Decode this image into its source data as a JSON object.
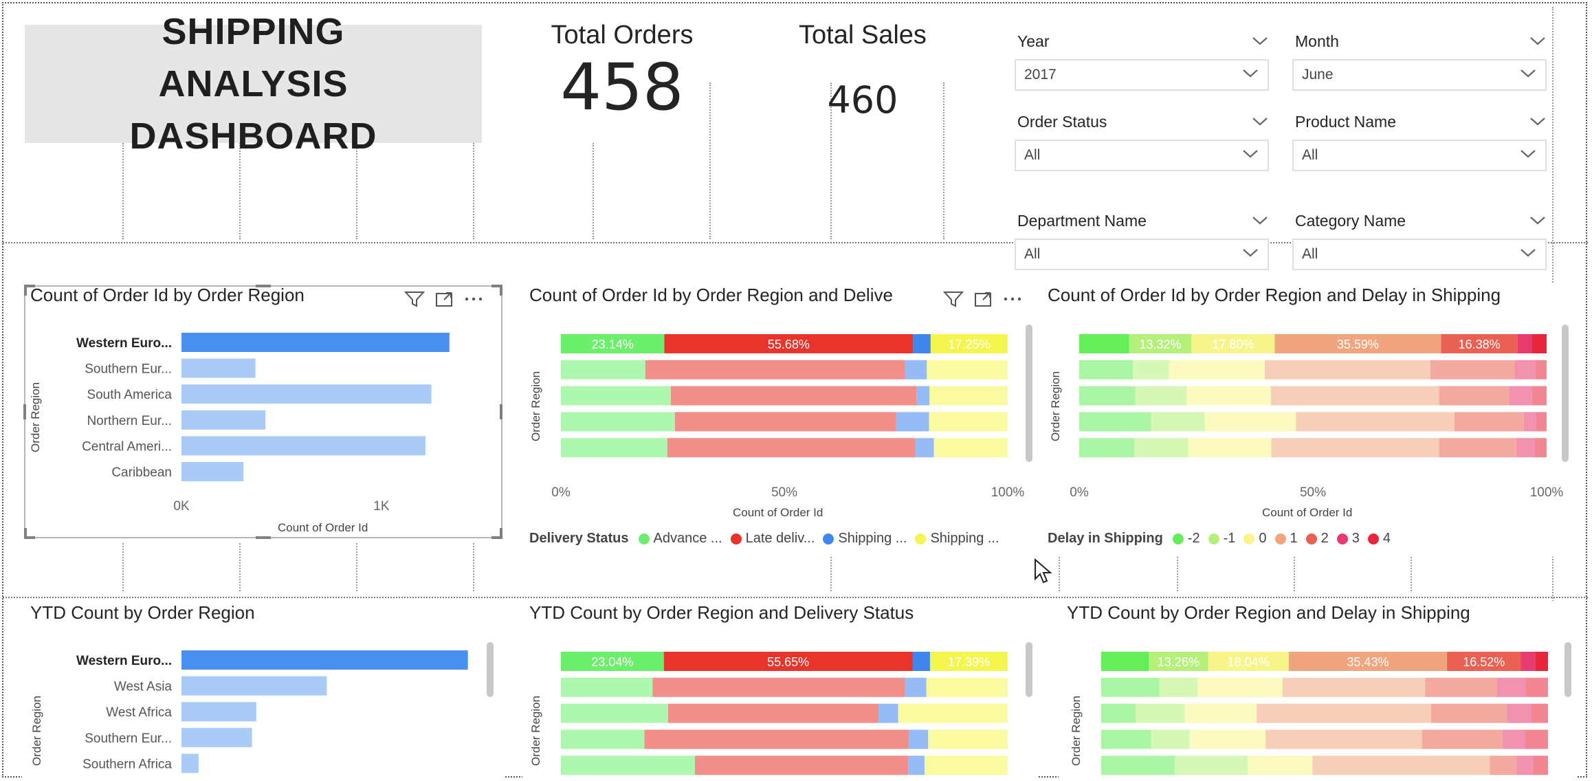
{
  "header": {
    "title": "SHIPPING ANALYSIS DASHBOARD"
  },
  "kpis": {
    "total_orders": {
      "label": "Total Orders",
      "value": "458"
    },
    "total_sales": {
      "label": "Total Sales",
      "value": "460"
    }
  },
  "slicers": [
    {
      "name": "Year",
      "value": "2017"
    },
    {
      "name": "Month",
      "value": "June"
    },
    {
      "name": "Order Status",
      "value": "All"
    },
    {
      "name": "Product Name",
      "value": "All"
    },
    {
      "name": "Department Name",
      "value": "All"
    },
    {
      "name": "Category Name",
      "value": "All"
    }
  ],
  "icons": [
    "filter-icon",
    "focus-mode-icon",
    "more-options-icon",
    "chevron-down-icon",
    "cursor-icon"
  ],
  "colors": {
    "bar_selected": "#4a90f0",
    "bar_default": "#aacbf6",
    "advance": "#6cf06c",
    "late": "#e8342a",
    "shipping_canceled": "#3f86ef",
    "shipping_on_time": "#f5f54f"
  },
  "chart_data": [
    {
      "type": "bar",
      "title": "Count of Order Id by Order Region",
      "xlabel": "Count of Order Id",
      "ylabel": "Order Region",
      "categories": [
        "Western Euro...",
        "Southern Eur...",
        "South America",
        "Northern Eur...",
        "Central Ameri...",
        "Caribbean"
      ],
      "values": [
        1340,
        370,
        1250,
        420,
        1220,
        310
      ],
      "highlighted": "Western Euro...",
      "xticks": [
        "0K",
        "1K"
      ],
      "xlim": [
        0,
        1650
      ]
    },
    {
      "type": "bar",
      "stacked": "100%",
      "title": "Count of Order Id by Order Region and Delivery Status",
      "title_visible": "Count of Order Id by Order Region and Delive",
      "xlabel": "Count of Order Id",
      "ylabel": "Order Region",
      "xticks": [
        "0%",
        "50%",
        "100%"
      ],
      "legend_title": "Delivery Status",
      "legend": [
        "Advance ...",
        "Late deliv...",
        "Shipping ...",
        "Shipping ..."
      ],
      "series_colors": [
        "#6cf06c",
        "#e8342a",
        "#3f86ef",
        "#f5f54f"
      ],
      "rows": [
        [
          23.14,
          55.68,
          3.93,
          17.25
        ],
        [
          18.9,
          58.1,
          4.9,
          18.1
        ],
        [
          24.6,
          55.0,
          2.9,
          17.5
        ],
        [
          25.5,
          49.5,
          7.4,
          17.6
        ],
        [
          23.8,
          55.6,
          4.1,
          16.5
        ]
      ],
      "data_labels": [
        "23.14%",
        "55.68%",
        "",
        "17.25%"
      ]
    },
    {
      "type": "bar",
      "stacked": "100%",
      "title": "Count of Order Id by Order Region and Delay in Shipping",
      "xlabel": "Count of Order Id",
      "ylabel": "Order Region",
      "xticks": [
        "0%",
        "50%",
        "100%"
      ],
      "legend_title": "Delay in Shipping",
      "legend": [
        "-2",
        "-1",
        "0",
        "1",
        "2",
        "3",
        "4"
      ],
      "series_colors": [
        "#66ee5a",
        "#b4f07a",
        "#f7f58a",
        "#f1a57e",
        "#ea6053",
        "#e53b6f",
        "#e8253a"
      ],
      "rows": [
        [
          10.7,
          13.32,
          17.8,
          35.59,
          16.38,
          3.0,
          3.21
        ],
        [
          11.5,
          7.7,
          20.5,
          35.4,
          18.0,
          4.5,
          2.4
        ],
        [
          12.0,
          11.0,
          18.0,
          36.0,
          15.0,
          4.8,
          3.2
        ],
        [
          15.4,
          11.5,
          19.5,
          33.9,
          14.8,
          2.6,
          2.3
        ],
        [
          11.8,
          11.5,
          17.8,
          35.9,
          16.5,
          4.0,
          2.5
        ]
      ],
      "data_labels": [
        "",
        "13.32%",
        "17.80%",
        "35.59%",
        "16.38%",
        "",
        ""
      ]
    },
    {
      "type": "bar",
      "title": "YTD Count by Order Region",
      "ylabel": "Order Region",
      "categories": [
        "Western Euro...",
        "West Asia",
        "West Africa",
        "Southern Eur...",
        "Southern Africa"
      ],
      "values": [
        1340,
        680,
        350,
        330,
        80
      ],
      "highlighted": "Western Euro..."
    },
    {
      "type": "bar",
      "stacked": "100%",
      "title": "YTD Count by Order Region and Delivery Status",
      "ylabel": "Order Region",
      "series_colors": [
        "#6cf06c",
        "#e8342a",
        "#3f86ef",
        "#f5f54f"
      ],
      "rows": [
        [
          23.04,
          55.65,
          3.92,
          17.39
        ],
        [
          20.5,
          56.5,
          4.8,
          18.2
        ],
        [
          24.0,
          47.1,
          4.4,
          24.5
        ],
        [
          18.7,
          59.2,
          4.3,
          17.8
        ],
        [
          30.0,
          47.7,
          3.7,
          18.6
        ]
      ],
      "data_labels": [
        "23.04%",
        "55.65%",
        "",
        "17.39%"
      ]
    },
    {
      "type": "bar",
      "stacked": "100%",
      "title": "YTD Count by Order Region and Delay in Shipping",
      "ylabel": "Order Region",
      "series_colors": [
        "#66ee5a",
        "#b4f07a",
        "#f7f58a",
        "#f1a57e",
        "#ea6053",
        "#e53b6f",
        "#e8253a"
      ],
      "rows": [
        [
          10.67,
          13.26,
          18.04,
          35.43,
          16.52,
          3.2,
          2.88
        ],
        [
          13.0,
          8.6,
          19.0,
          31.9,
          16.0,
          6.5,
          5.0
        ],
        [
          7.7,
          11.0,
          16.1,
          39.0,
          17.0,
          5.4,
          3.8
        ],
        [
          11.2,
          8.6,
          17.0,
          35.0,
          18.0,
          5.0,
          5.2
        ],
        [
          16.5,
          16.3,
          14.5,
          39.7,
          6.0,
          3.5,
          3.5
        ]
      ],
      "data_labels": [
        "",
        "13.26%",
        "18.04%",
        "35.43%",
        "16.52%",
        "",
        ""
      ]
    }
  ]
}
